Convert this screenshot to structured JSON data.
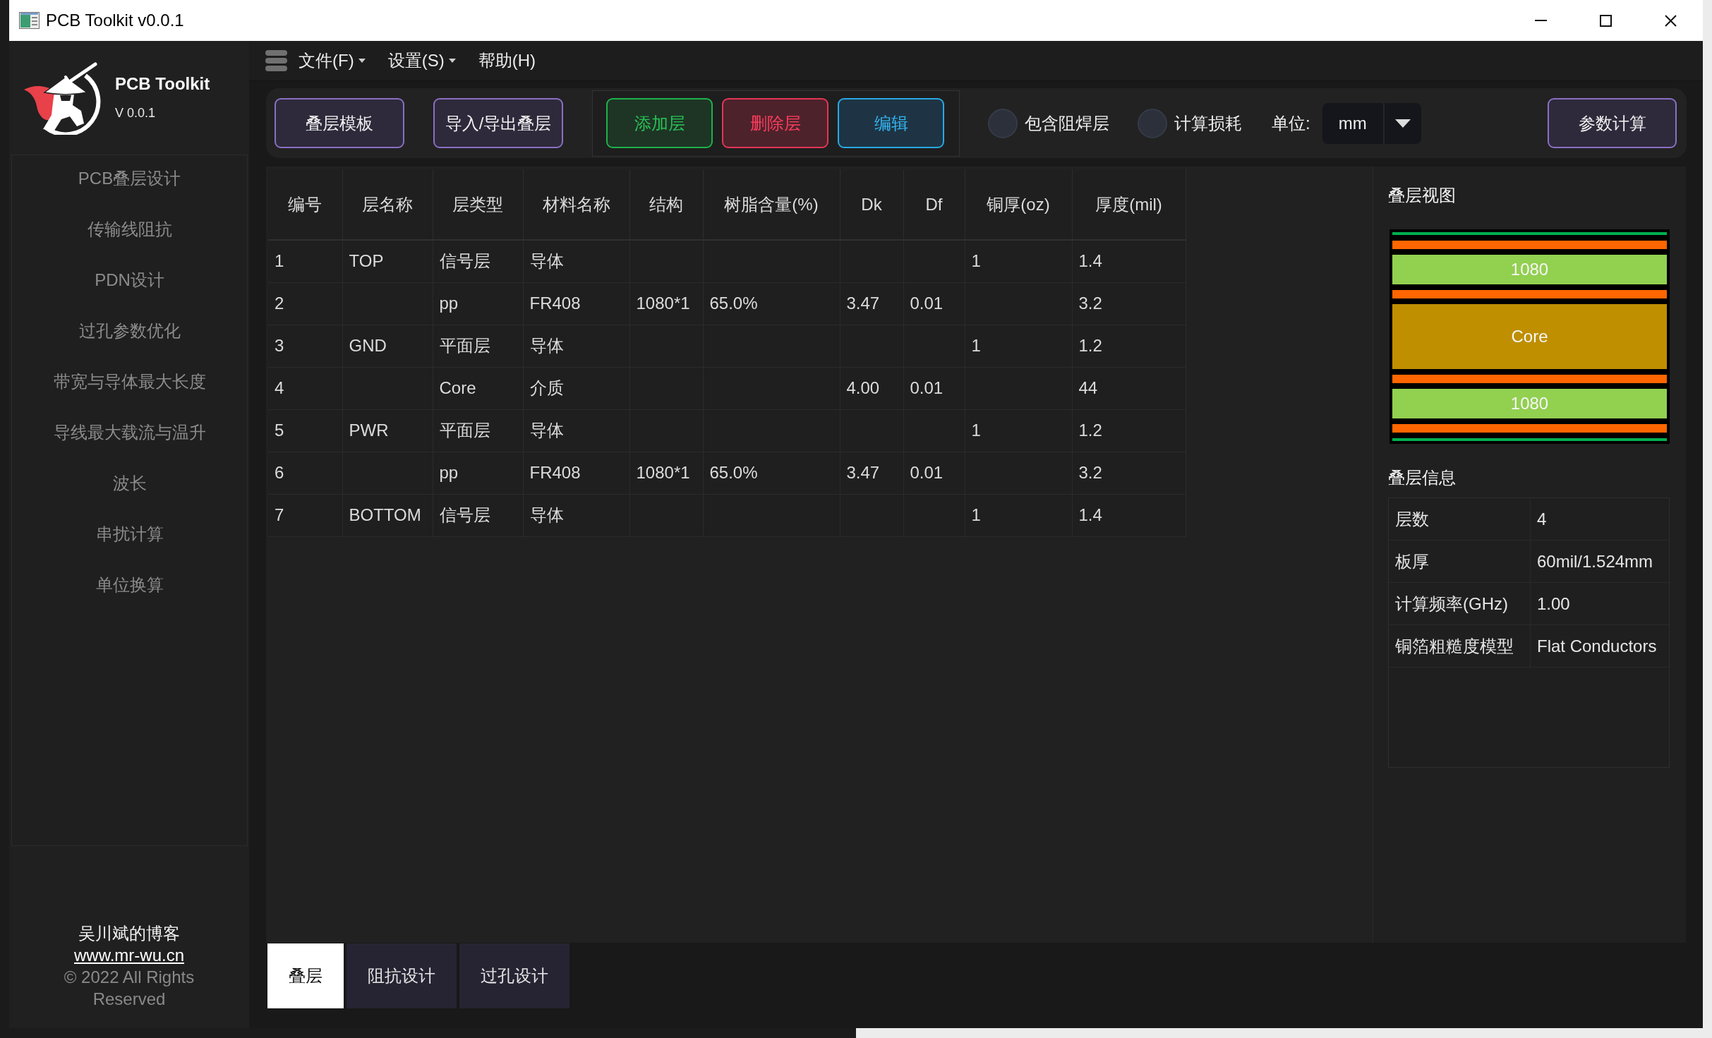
{
  "window": {
    "title": "PCB Toolkit v0.0.1"
  },
  "sidebar": {
    "app_name": "PCB Toolkit",
    "version": "V 0.0.1",
    "items": [
      "PCB叠层设计",
      "传输线阻抗",
      "PDN设计",
      "过孔参数优化",
      "带宽与导体最大长度",
      "导线最大载流与温升",
      "波长",
      "串扰计算",
      "单位换算"
    ],
    "footer": {
      "blog": "吴川斌的博客",
      "link": "www.mr-wu.cn",
      "copyright": "© 2022 All Rights Reserved"
    }
  },
  "menu": [
    {
      "label": "文件(F)",
      "has_submenu": true
    },
    {
      "label": "设置(S)",
      "has_submenu": true
    },
    {
      "label": "帮助(H)",
      "has_submenu": false
    }
  ],
  "toolbar": {
    "buttons": [
      "叠层模板",
      "导入/导出叠层"
    ],
    "layer_buttons": [
      {
        "label": "添加层",
        "kind": "add"
      },
      {
        "label": "删除层",
        "kind": "delete"
      },
      {
        "label": "编辑",
        "kind": "edit"
      }
    ],
    "options": [
      {
        "label": "包含阻焊层",
        "checked": false
      },
      {
        "label": "计算损耗",
        "checked": false
      }
    ],
    "unit": {
      "label": "单位:",
      "value": "mm"
    },
    "calculate_button": "参数计算"
  },
  "table": {
    "columns": [
      "编号",
      "层名称",
      "层类型",
      "材料名称",
      "结构",
      "树脂含量(%)",
      "Dk",
      "Df",
      "铜厚(oz)",
      "厚度(mil)"
    ],
    "rows": [
      {
        "number": "1",
        "layer_name": "TOP",
        "layer_type": "信号层",
        "material": "导体",
        "copper_oz": "1",
        "thickness_mil": "1.4"
      },
      {
        "number": "2",
        "layer_type": "pp",
        "material": "FR408",
        "structure": "1080*1",
        "resin_content": "65.0%",
        "dk": "3.47",
        "df": "0.01",
        "thickness_mil": "3.2"
      },
      {
        "number": "3",
        "layer_name": "GND",
        "layer_type": "平面层",
        "material": "导体",
        "copper_oz": "1",
        "thickness_mil": "1.2"
      },
      {
        "number": "4",
        "layer_type": "Core",
        "material": "介质",
        "dk": "4.00",
        "df": "0.01",
        "thickness_mil": "44"
      },
      {
        "number": "5",
        "layer_name": "PWR",
        "layer_type": "平面层",
        "material": "导体",
        "copper_oz": "1",
        "thickness_mil": "1.2"
      },
      {
        "number": "6",
        "layer_type": "pp",
        "material": "FR408",
        "structure": "1080*1",
        "resin_content": "65.0%",
        "dk": "3.47",
        "df": "0.01",
        "thickness_mil": "3.2"
      },
      {
        "number": "7",
        "layer_name": "BOTTOM",
        "layer_type": "信号层",
        "material": "导体",
        "copper_oz": "1",
        "thickness_mil": "1.4"
      }
    ]
  },
  "stackup_view": {
    "title": "叠层视图",
    "layers": [
      {
        "kind": "solder_mask"
      },
      {
        "kind": "copper"
      },
      {
        "kind": "prepreg",
        "label": "1080"
      },
      {
        "kind": "copper"
      },
      {
        "kind": "core",
        "label": "Core"
      },
      {
        "kind": "copper"
      },
      {
        "kind": "prepreg",
        "label": "1080"
      },
      {
        "kind": "copper"
      },
      {
        "kind": "solder_mask"
      }
    ]
  },
  "stackup_info": {
    "title": "叠层信息",
    "rows": [
      {
        "label": "层数",
        "value": "4"
      },
      {
        "label": "板厚",
        "value": "60mil/1.524mm"
      },
      {
        "label": "计算频率(GHz)",
        "value": "1.00"
      },
      {
        "label": "铜箔粗糙度模型",
        "value": "Flat Conductors"
      }
    ]
  },
  "bottom_tabs": [
    {
      "label": "叠层",
      "selected": true
    },
    {
      "label": "阻抗设计",
      "selected": false
    },
    {
      "label": "过孔设计",
      "selected": false
    }
  ]
}
